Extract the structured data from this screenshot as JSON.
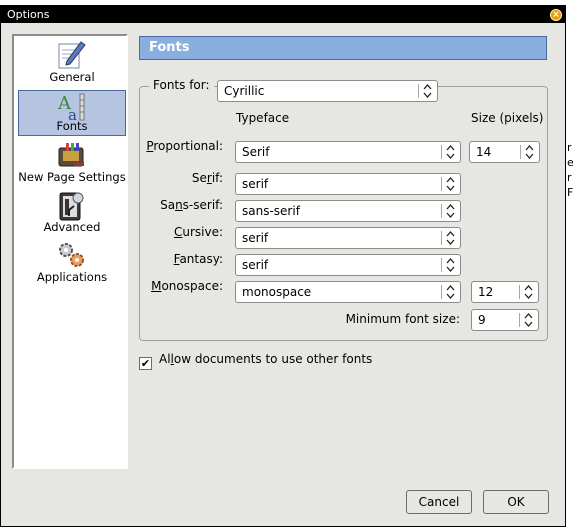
{
  "window": {
    "title": "Options"
  },
  "background_fragments": [
    "r",
    "e",
    "r",
    "F"
  ],
  "sidebar": {
    "items": [
      {
        "label": "General",
        "icon": "general-icon"
      },
      {
        "label": "Fonts",
        "icon": "fonts-icon",
        "selected": true
      },
      {
        "label": "New Page Settings",
        "icon": "new-page-settings-icon"
      },
      {
        "label": "Advanced",
        "icon": "advanced-icon"
      },
      {
        "label": "Applications",
        "icon": "applications-icon"
      }
    ]
  },
  "panel": {
    "header": "Fonts",
    "fonts_for_label": "Fonts for:",
    "fonts_for_value": "Cyrillic",
    "col_typeface": "Typeface",
    "col_size": "Size (pixels)",
    "rows": [
      {
        "label": "Proportional:",
        "accel": "P",
        "rest": "roportional:",
        "value": "Serif",
        "size": "14"
      },
      {
        "label": "Serif:",
        "accel": "r",
        "value": "serif"
      },
      {
        "label": "Sans-serif:",
        "accel": "n",
        "value": "sans-serif"
      },
      {
        "label": "Cursive:",
        "accel": "C",
        "value": "serif"
      },
      {
        "label": "Fantasy:",
        "accel": "F",
        "value": "serif"
      },
      {
        "label": "Monospace:",
        "accel": "M",
        "value": "monospace",
        "size": "12"
      }
    ],
    "min_font_label": "Minimum font size:",
    "min_font_value": "9",
    "allow_label": "Allow documents to use other fonts",
    "allow_checked": true
  },
  "buttons": {
    "cancel": "Cancel",
    "ok": "OK"
  },
  "colors": {
    "header": "#8aaede",
    "selected": "#b5c4e0",
    "dialog": "#e6e6e2"
  }
}
